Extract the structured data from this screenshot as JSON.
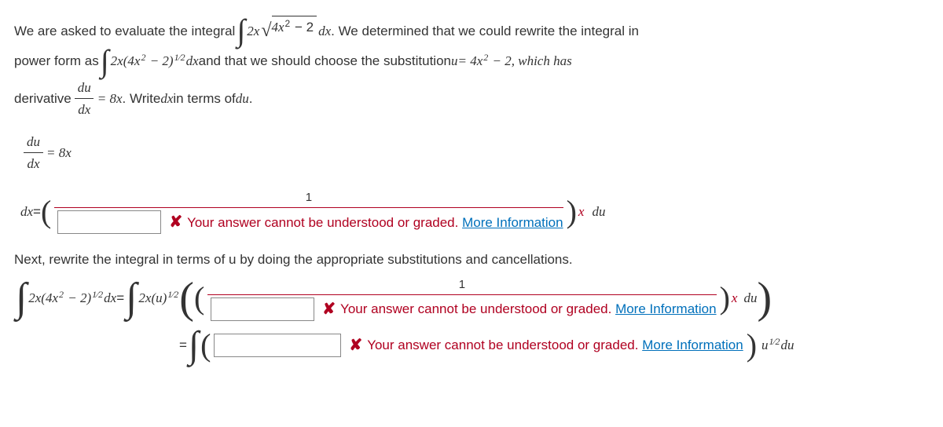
{
  "intro": {
    "t1": "We are asked to evaluate the integral ",
    "expr_2x": "2",
    "x": "x",
    "sq_body_a": "4",
    "sq_body_b": "2",
    "minus": " − ",
    "two": "2",
    "dx": " dx",
    "t2": ". We determined that we could rewrite the integral in"
  },
  "power": {
    "t1": "power form as ",
    "expr_a": "2",
    "expr_b": "(4",
    "expr_c": " − 2)",
    "half": "1⁄2",
    "dx": " dx",
    "t2": " and that we should choose the substitution ",
    "u": "u",
    "eq": " = 4",
    "minus2": " − 2, which has"
  },
  "deriv": {
    "t1": "derivative ",
    "du": "du",
    "dx": "dx",
    "eq8x": " = 8",
    "t2": ". Write ",
    "dxi": "dx",
    "t3": " in terms of ",
    "dui": "du",
    "dot": "."
  },
  "eq1": {
    "du": "du",
    "dx": "dx",
    "eq": " = 8"
  },
  "ans1": {
    "lhs": "dx",
    "eq": " = ",
    "one": "1",
    "du": "du"
  },
  "err": {
    "msg": "Your answer cannot be understood or graded.",
    "link": "More Information"
  },
  "next": {
    "t": "Next, rewrite the integral in terms of u by doing the appropriate substitutions and cancellations."
  },
  "ans2": {
    "lhs_a": "2",
    "lhs_b": "(4",
    "lhs_c": " − 2)",
    "half": "1⁄2",
    "dx": "dx",
    "eq": " = ",
    "rhs_a": "2",
    "u_pow": "(u)",
    "one": "1",
    "du": "du"
  },
  "ans3": {
    "eq": " = ",
    "u_half_du": "u",
    "half": "1⁄2",
    "du": "du"
  }
}
